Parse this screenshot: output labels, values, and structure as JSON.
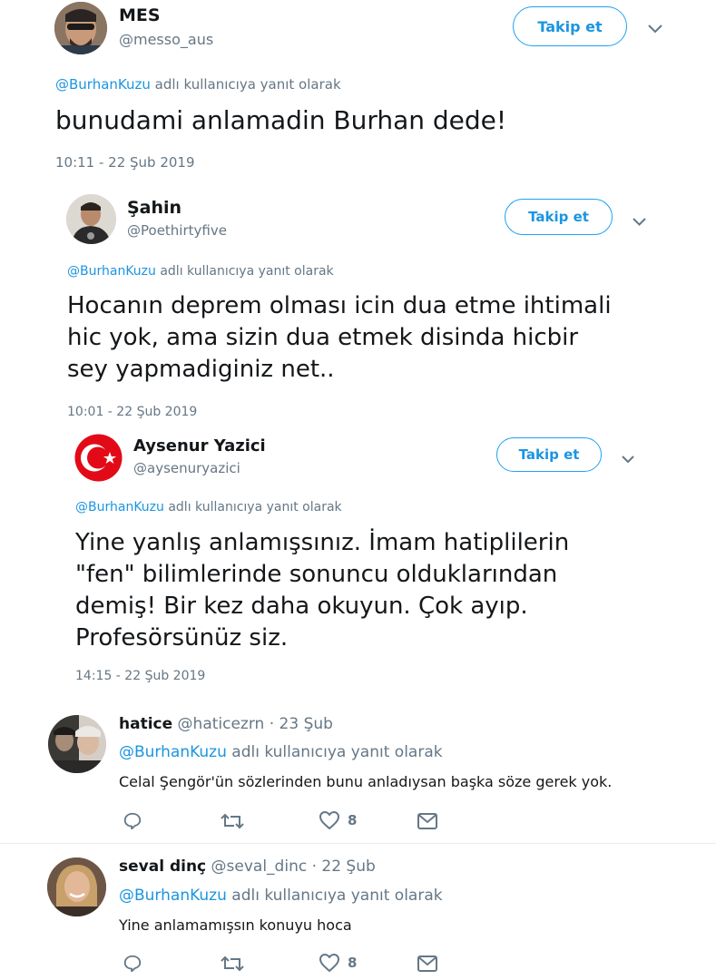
{
  "tweets": [
    {
      "name": "MES",
      "handle": "@messo_aus",
      "follow_label": "Takip et",
      "reply_mention": "@BurhanKuzu",
      "reply_suffix": " adlı kullanıcıya yanıt olarak",
      "text": "bunudami anlamadin Burhan dede!",
      "time": "10:11 - 22 Şub 2019"
    },
    {
      "name": "Şahin",
      "handle": "@Poethirtyfive",
      "follow_label": "Takip et",
      "reply_mention": "@BurhanKuzu",
      "reply_suffix": " adlı kullanıcıya yanıt olarak",
      "text": "Hocanın deprem olması icin dua etme ihtimali\nhic yok, ama sizin dua etmek disinda hicbir\nsey yapmadiginiz net..",
      "time": "10:01 - 22 Şub 2019"
    },
    {
      "name": "Aysenur Yazici",
      "handle": "@aysenuryazici",
      "follow_label": "Takip et",
      "reply_mention": "@BurhanKuzu",
      "reply_suffix": " adlı kullanıcıya yanıt olarak",
      "text": "Yine yanlış anlamışsınız. İmam hatiplilerin\n\"fen\" bilimlerinde sonuncu olduklarından\ndemiş! Bir kez daha okuyun. Çok ayıp.\nProfesörsünüz siz.",
      "time": "14:15 - 22 Şub 2019"
    }
  ],
  "replies": [
    {
      "name": "hatice",
      "handle": "@haticezrn",
      "date": " · 23 Şub",
      "reply_mention": "@BurhanKuzu",
      "reply_suffix": " adlı kullanıcıya yanıt olarak",
      "text": "Celal Şengör'ün sözlerinden bunu anladıysan başka söze gerek yok.",
      "likes": "8"
    },
    {
      "name": "seval dinç",
      "handle": "@seval_dinc",
      "date": " · 22 Şub",
      "reply_mention": "@BurhanKuzu",
      "reply_suffix": " adlı kullanıcıya yanıt olarak",
      "text": "Yine anlamamışsın konuyu hoca",
      "likes": "8"
    }
  ],
  "colors": {
    "accent": "#1da1f2",
    "link": "#1b95e0",
    "muted": "#657786",
    "text": "#14171a",
    "divider": "#e6ecf0"
  }
}
